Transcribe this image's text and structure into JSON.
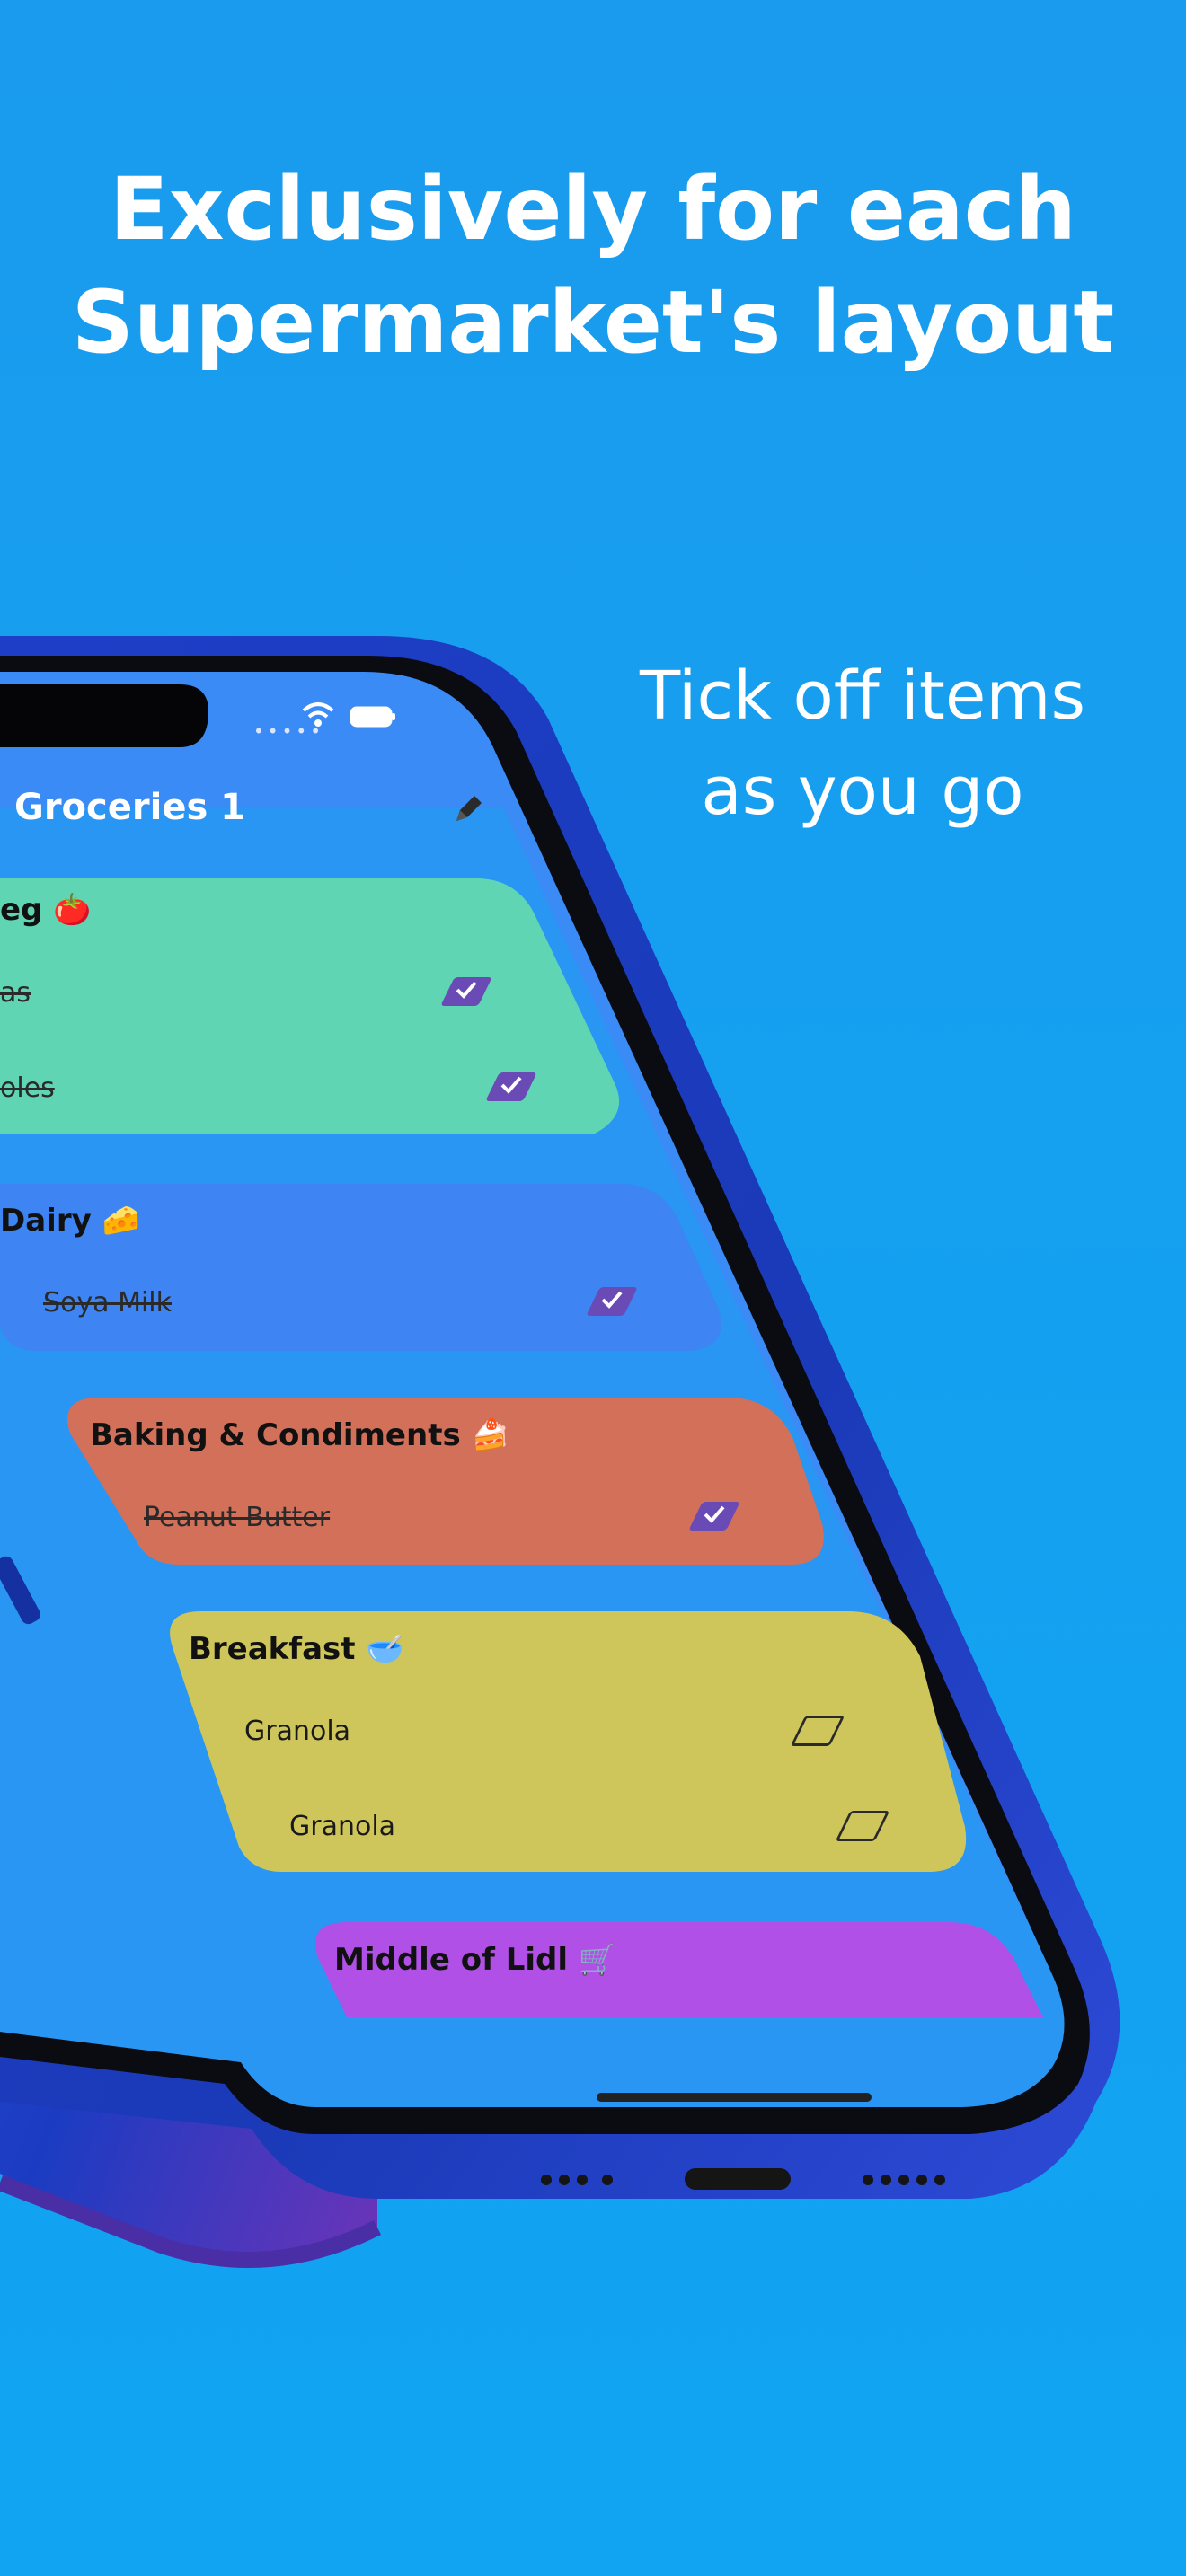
{
  "headline": [
    "Exclusively for each",
    "Supermarket's layout"
  ],
  "tagline": [
    "Tick off items",
    "as you go"
  ],
  "colors": {
    "background": "#12a0f1",
    "app_background": "#3e8ef7",
    "fruit_veg_card": "#5fd5b4",
    "dairy_card": "#3e84f3",
    "baking_card": "#d2705a",
    "breakfast_card": "#cfc65b",
    "middle_card": "#b150e6",
    "checkbox": "#6a4bb6",
    "frame": "#1d3fc7"
  },
  "app": {
    "title": "Groceries 1",
    "edit_icon": "pencil-icon",
    "status": {
      "wifi_icon": "wifi-icon",
      "battery_icon": "battery-icon"
    }
  },
  "sections": [
    {
      "title": "eg 🍅",
      "items": [
        {
          "label": "as",
          "checked": true
        },
        {
          "label": "oles",
          "checked": true
        }
      ]
    },
    {
      "title": "Dairy 🧀",
      "items": [
        {
          "label": "Soya Milk",
          "checked": true
        }
      ]
    },
    {
      "title": "Baking & Condiments 🍰",
      "items": [
        {
          "label": "Peanut Butter",
          "checked": true
        }
      ]
    },
    {
      "title": "Breakfast 🥣",
      "items": [
        {
          "label": "Granola",
          "checked": false
        },
        {
          "label": "Granola",
          "checked": false
        }
      ]
    },
    {
      "title": "Middle of Lidl 🛒",
      "items": []
    }
  ]
}
